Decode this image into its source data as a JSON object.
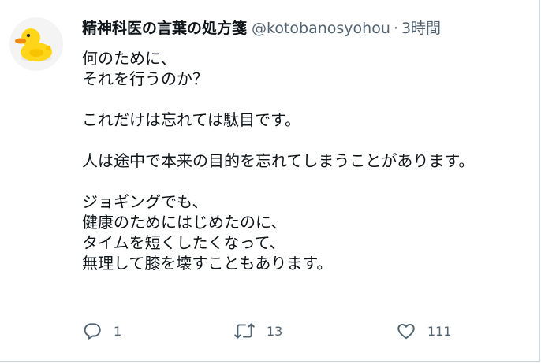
{
  "tweet": {
    "display_name": "精神科医の言葉の処方箋",
    "handle": "@kotobanosyohou",
    "separator": "·",
    "time": "3時間",
    "avatar_icon": "rubber-duck-icon",
    "lines": [
      "何のために、",
      "それを行うのか？",
      "",
      "これだけは忘れては駄目です。",
      "",
      "人は途中で本来の目的を忘れてしまうことがあります。",
      "",
      "ジョギングでも、",
      "健康のためにはじめたのに、",
      "タイムを短くしたくなって、",
      "無理して膝を壊すこともあります。"
    ],
    "actions": {
      "reply_icon": "reply-icon",
      "reply_count": "1",
      "retweet_icon": "retweet-icon",
      "retweet_count": "13",
      "like_icon": "heart-icon",
      "like_count": "111"
    },
    "colors": {
      "text": "#0f1419",
      "secondary": "#536471",
      "border": "#cfd9de",
      "duck": "#ffd51a",
      "beak": "#f28a12"
    }
  }
}
